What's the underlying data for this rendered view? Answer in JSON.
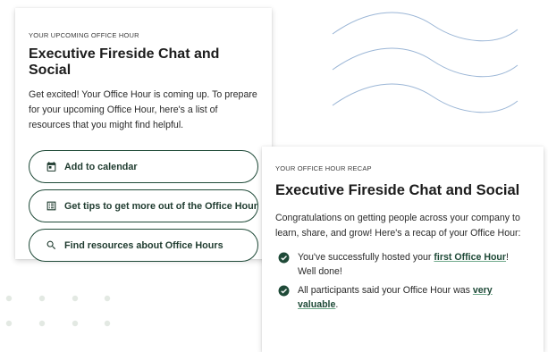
{
  "upcoming": {
    "eyebrow": "YOUR UPCOMING OFFICE HOUR",
    "title": "Executive Fireside Chat and Social",
    "body": "Get excited! Your Office Hour is coming up. To prepare for your upcoming Office Hour, here's a list of resources that you might find helpful.",
    "buttons": [
      {
        "label": "Add to calendar",
        "icon": "calendar-icon"
      },
      {
        "label": "Get tips to get more out of the Office Hour",
        "icon": "list-icon"
      },
      {
        "label": "Find resources about Office Hours",
        "icon": "search-icon"
      }
    ]
  },
  "recap": {
    "eyebrow": "YOUR OFFICE HOUR RECAP",
    "title": "Executive Fireside Chat and Social",
    "body": "Congratulations on getting people across your company to learn, share, and grow! Here's a recap of your Office Hour:",
    "items": [
      {
        "before": "You've successfully hosted your ",
        "link": "first Office Hour",
        "after": "! Well done!",
        "icon": "check-circle-icon"
      },
      {
        "before": "All participants said your Office Hour was ",
        "link": "very valuable",
        "after": ".",
        "icon": "check-circle-icon"
      }
    ]
  },
  "colors": {
    "accent": "#1f4a38",
    "wave": "#9bb6d6",
    "dots": "#e6ece6"
  }
}
